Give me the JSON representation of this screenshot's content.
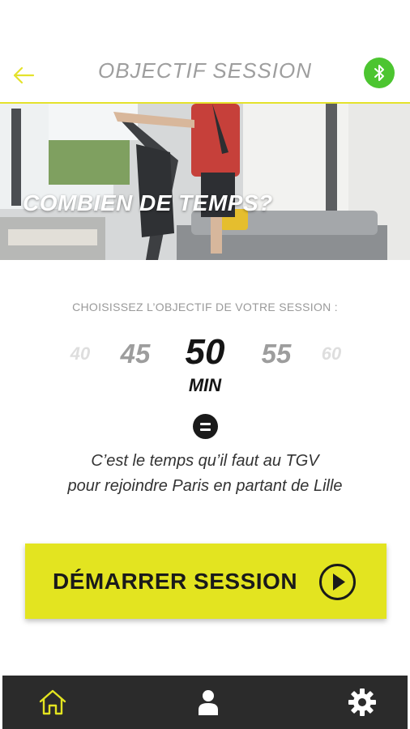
{
  "header": {
    "title": "OBJECTIF SESSION",
    "back_icon": "arrow-left-icon",
    "bluetooth_icon": "bluetooth-icon"
  },
  "hero": {
    "caption": "COMBIEN DE TEMPS?"
  },
  "goal": {
    "instruction": "CHOISISSEZ L’OBJECTIF DE VOTRE SESSION :",
    "options": [
      "40",
      "45",
      "50",
      "55",
      "60"
    ],
    "selected": "50",
    "unit": "MIN",
    "equals_icon": "equals-icon",
    "comparison_line1": "C’est le temps qu’il faut au TGV",
    "comparison_line2": "pour rejoindre Paris en partant de Lille"
  },
  "start_button": {
    "label": "DÉMARRER SESSION",
    "icon": "play-circle-icon"
  },
  "bottom_nav": {
    "items": [
      {
        "name": "home",
        "icon": "home-icon",
        "active": true
      },
      {
        "name": "profile",
        "icon": "user-icon",
        "active": false
      },
      {
        "name": "settings",
        "icon": "gear-icon",
        "active": false
      }
    ]
  },
  "colors": {
    "accent": "#e3e420",
    "bluetooth": "#4cc530",
    "nav_background": "#2b2b2b",
    "title_gray": "#9e9e9e"
  }
}
